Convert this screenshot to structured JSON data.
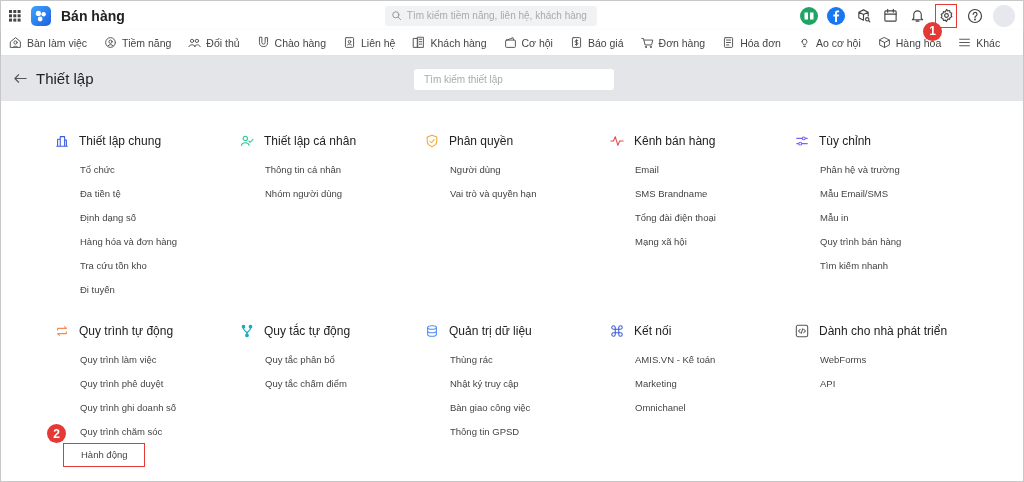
{
  "app": {
    "title": "Bán hàng"
  },
  "search": {
    "placeholder": "Tìm kiếm tiềm năng, liên hệ, khách hàng"
  },
  "toolbar": {
    "settings_callout": "1"
  },
  "nav": [
    {
      "label": "Bàn làm việc"
    },
    {
      "label": "Tiềm năng"
    },
    {
      "label": "Đối thủ"
    },
    {
      "label": "Chào hàng"
    },
    {
      "label": "Liên hệ"
    },
    {
      "label": "Khách hàng"
    },
    {
      "label": "Cơ hội"
    },
    {
      "label": "Báo giá"
    },
    {
      "label": "Đơn hàng"
    },
    {
      "label": "Hóa đơn"
    },
    {
      "label": "Ao cơ hội"
    },
    {
      "label": "Hàng hóa"
    },
    {
      "label": "Khác"
    }
  ],
  "page": {
    "title": "Thiết lập",
    "search_placeholder": "Tìm kiếm thiết lập"
  },
  "sections": [
    {
      "title": "Thiết lập chung",
      "items": [
        {
          "label": "Tổ chức"
        },
        {
          "label": "Đa tiền tệ"
        },
        {
          "label": "Định dạng số"
        },
        {
          "label": "Hàng hóa và đơn hàng"
        },
        {
          "label": "Tra cứu tồn kho"
        },
        {
          "label": "Đi tuyến"
        }
      ]
    },
    {
      "title": "Thiết lập cá nhân",
      "items": [
        {
          "label": "Thông tin cá nhân"
        },
        {
          "label": "Nhóm người dùng"
        }
      ]
    },
    {
      "title": "Phân quyền",
      "items": [
        {
          "label": "Người dùng"
        },
        {
          "label": "Vai trò và quyền hạn"
        }
      ]
    },
    {
      "title": "Kênh bán hàng",
      "items": [
        {
          "label": "Email"
        },
        {
          "label": "SMS Brandname"
        },
        {
          "label": "Tổng đài điện thoại"
        },
        {
          "label": "Mạng xã hội"
        }
      ]
    },
    {
      "title": "Tùy chỉnh",
      "items": [
        {
          "label": "Phân hệ và trường"
        },
        {
          "label": "Mẫu Email/SMS"
        },
        {
          "label": "Mẫu in"
        },
        {
          "label": "Quy trình bán hàng"
        },
        {
          "label": "Tìm kiếm nhanh"
        }
      ]
    },
    {
      "title": "Quy trình tự động",
      "items": [
        {
          "label": "Quy trình làm việc"
        },
        {
          "label": "Quy trình phê duyệt"
        },
        {
          "label": "Quy trình ghi doanh số"
        },
        {
          "label": "Quy trình chăm sóc"
        },
        {
          "label": "Hành động",
          "callout": "2"
        }
      ]
    },
    {
      "title": "Quy tắc tự động",
      "items": [
        {
          "label": "Quy tắc phân bổ"
        },
        {
          "label": "Quy tắc chấm điểm"
        }
      ]
    },
    {
      "title": "Quản trị dữ liệu",
      "items": [
        {
          "label": "Thùng rác"
        },
        {
          "label": "Nhật ký truy cập"
        },
        {
          "label": "Bàn giao công việc"
        },
        {
          "label": "Thông tin GPSD"
        }
      ]
    },
    {
      "title": "Kết nối",
      "items": [
        {
          "label": "AMIS.VN - Kế toán"
        },
        {
          "label": "Marketing"
        },
        {
          "label": "Omnichanel"
        }
      ]
    },
    {
      "title": "Dành cho nhà phát triển",
      "items": [
        {
          "label": "WebForms"
        },
        {
          "label": "API"
        }
      ]
    }
  ]
}
